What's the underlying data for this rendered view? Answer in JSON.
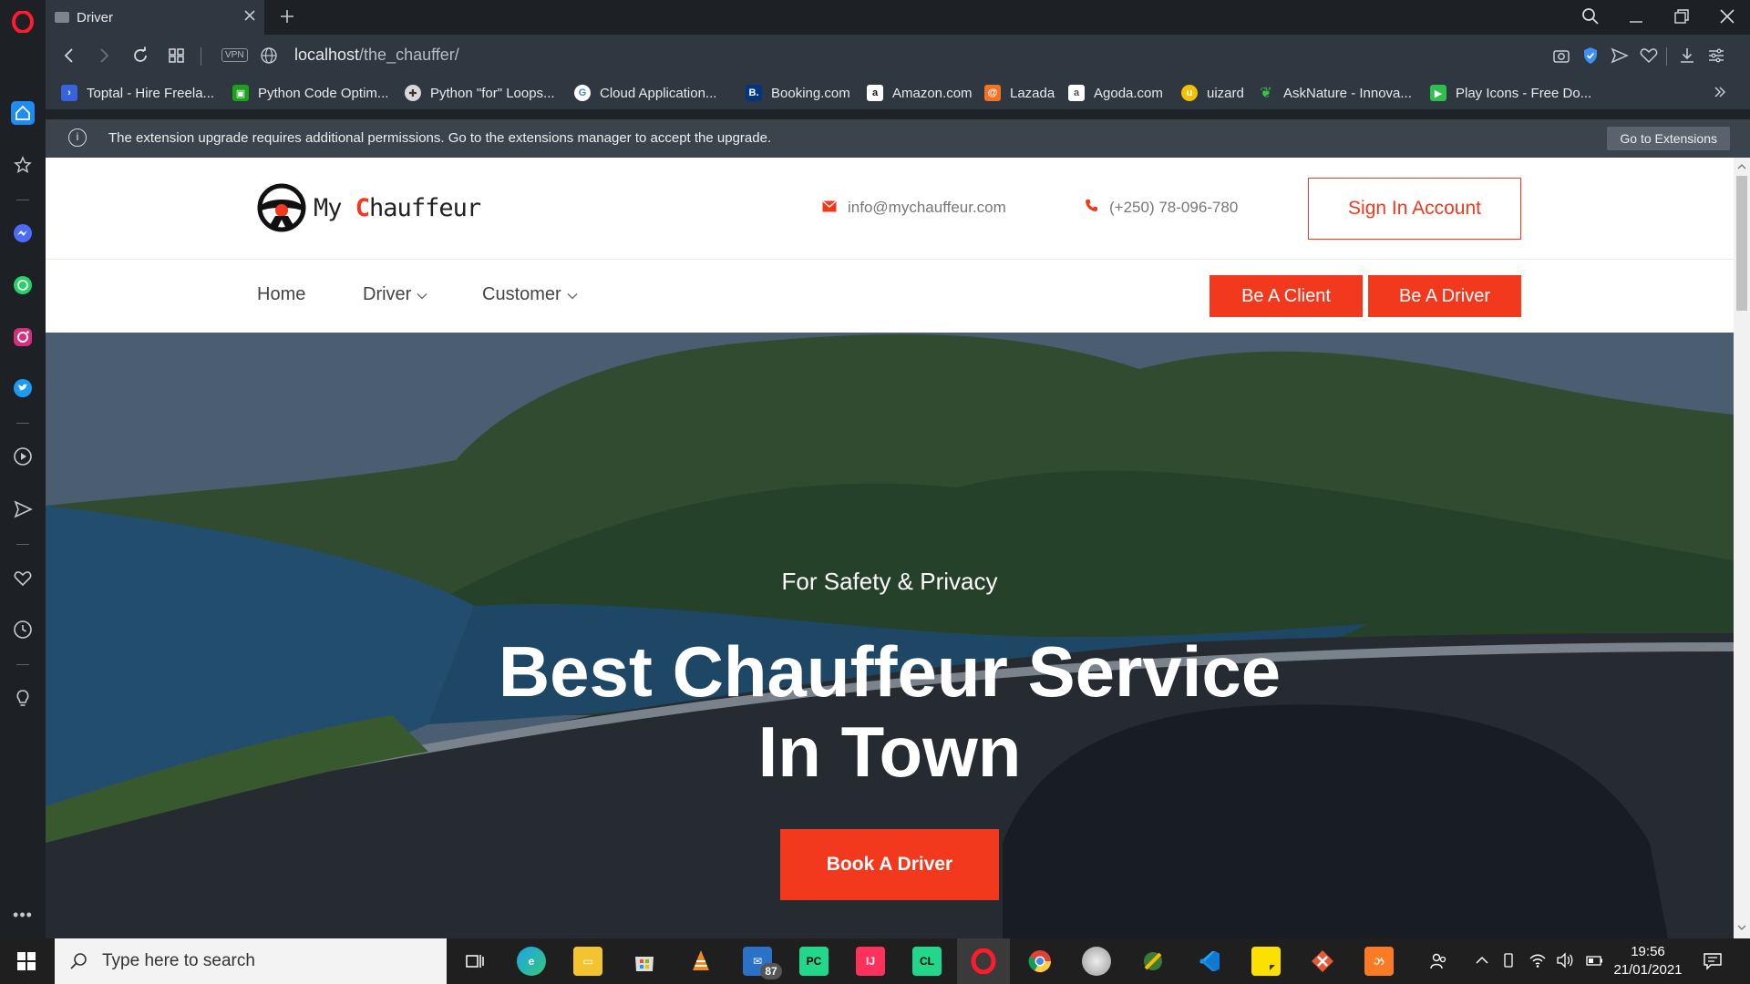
{
  "browser": {
    "tab_title": "Driver",
    "url_host": "localhost",
    "url_path": "/the_chauffer/",
    "vpn_label": "VPN"
  },
  "bookmarks": [
    {
      "label": "Toptal - Hire Freela...",
      "icon": "toptal-icon",
      "color": "#3863e0"
    },
    {
      "label": "Python Code Optim...",
      "icon": "python-code-icon",
      "color": "#1aa31a"
    },
    {
      "label": "Python \"for\" Loops...",
      "icon": "python-loops-icon",
      "color": "#d8d8d8"
    },
    {
      "label": "Cloud Application...",
      "icon": "google-icon",
      "color": "#ffffff"
    },
    {
      "label": "Booking.com",
      "icon": "booking-icon",
      "color": "#003580"
    },
    {
      "label": "Amazon.com",
      "icon": "amazon-icon",
      "color": "#ffffff"
    },
    {
      "label": "Lazada",
      "icon": "lazada-icon",
      "color": "#f57224"
    },
    {
      "label": "Agoda.com",
      "icon": "agoda-icon",
      "color": "#ffffff"
    },
    {
      "label": "uizard",
      "icon": "uizard-icon",
      "color": "#f2c200"
    },
    {
      "label": "AskNature - Innova...",
      "icon": "asknature-icon",
      "color": "#3cc24a"
    },
    {
      "label": "Play Icons - Free Do...",
      "icon": "play-icons-icon",
      "color": "#2fbf4f"
    }
  ],
  "extension_bar": {
    "message": "The extension upgrade requires additional permissions. Go to the extensions manager to accept the upgrade.",
    "button": "Go to Extensions"
  },
  "site": {
    "logo_my": "My",
    "logo_c": "C",
    "logo_rest": "hauffeur",
    "email": "info@mychauffeur.com",
    "phone": "(+250) 78-096-780",
    "signin": "Sign In Account",
    "nav": [
      "Home",
      "Driver",
      "Customer"
    ],
    "cta_client": "Be A Client",
    "cta_driver": "Be A Driver",
    "hero_sub": "For Safety & Privacy",
    "hero_title_1": "Best Chauffeur Service",
    "hero_title_2": "In Town",
    "hero_button": "Book A Driver",
    "accent": "#f2381d"
  },
  "taskbar": {
    "search_placeholder": "Type here to search",
    "mail_badge": "87",
    "time": "19:56",
    "date": "21/01/2021"
  }
}
